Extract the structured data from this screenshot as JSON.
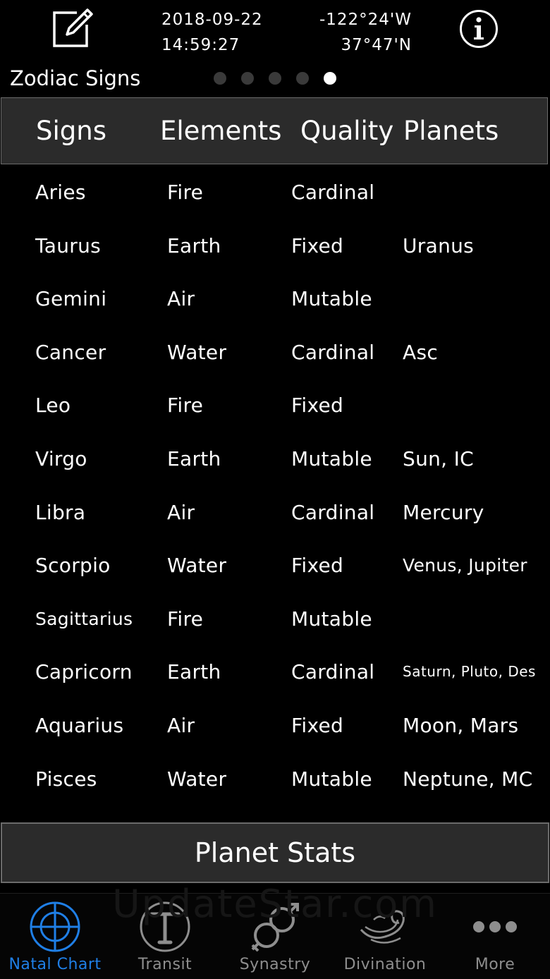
{
  "header": {
    "date": "2018-09-22",
    "time": "14:59:27",
    "longitude": "-122°24'W",
    "latitude": "37°47'N",
    "title": "Zodiac Signs",
    "page_count": 5,
    "active_page": 5
  },
  "table": {
    "columns": [
      "Signs",
      "Elements",
      "Quality",
      "Planets"
    ],
    "rows": [
      {
        "sign": "Aries",
        "element": "Fire",
        "quality": "Cardinal",
        "planets": ""
      },
      {
        "sign": "Taurus",
        "element": "Earth",
        "quality": "Fixed",
        "planets": "Uranus"
      },
      {
        "sign": "Gemini",
        "element": "Air",
        "quality": "Mutable",
        "planets": ""
      },
      {
        "sign": "Cancer",
        "element": "Water",
        "quality": "Cardinal",
        "planets": "Asc"
      },
      {
        "sign": "Leo",
        "element": "Fire",
        "quality": "Fixed",
        "planets": ""
      },
      {
        "sign": "Virgo",
        "element": "Earth",
        "quality": "Mutable",
        "planets": "Sun, IC"
      },
      {
        "sign": "Libra",
        "element": "Air",
        "quality": "Cardinal",
        "planets": "Mercury"
      },
      {
        "sign": "Scorpio",
        "element": "Water",
        "quality": "Fixed",
        "planets": "Venus, Jupiter"
      },
      {
        "sign": "Sagittarius",
        "element": "Fire",
        "quality": "Mutable",
        "planets": ""
      },
      {
        "sign": "Capricorn",
        "element": "Earth",
        "quality": "Cardinal",
        "planets": "Saturn, Pluto, Des"
      },
      {
        "sign": "Aquarius",
        "element": "Air",
        "quality": "Fixed",
        "planets": "Moon, Mars"
      },
      {
        "sign": "Pisces",
        "element": "Water",
        "quality": "Mutable",
        "planets": "Neptune, MC"
      }
    ]
  },
  "stats_button": {
    "label": "Planet Stats"
  },
  "watermark": "UpdateStar.com",
  "tabbar": {
    "tabs": [
      {
        "label": "Natal Chart",
        "icon": "crosshair-icon",
        "active": true
      },
      {
        "label": "Transit",
        "icon": "transit-icon",
        "active": false
      },
      {
        "label": "Synastry",
        "icon": "synastry-icon",
        "active": false
      },
      {
        "label": "Divination",
        "icon": "divination-icon",
        "active": false
      },
      {
        "label": "More",
        "icon": "more-dots-icon",
        "active": false
      }
    ]
  },
  "colors": {
    "background": "#000000",
    "header_bar": "#2b2b2b",
    "accent": "#1f7fe6",
    "inactive_tab": "#8e8e8e"
  }
}
